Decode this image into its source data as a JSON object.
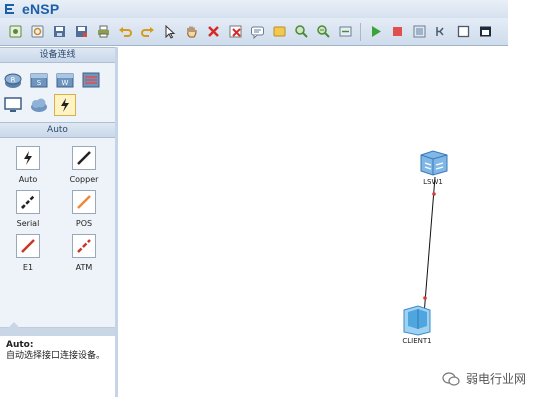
{
  "app": {
    "title": "eNSP"
  },
  "toolbar": {
    "icons": [
      "new-topology-icon",
      "open-icon",
      "save-icon",
      "save-as-icon",
      "print-icon",
      "undo-icon",
      "redo-icon",
      "select-icon",
      "pan-hand-icon",
      "delete-icon",
      "delete-all-icon",
      "text-icon",
      "palette-icon",
      "zoom-in-icon",
      "zoom-out-icon",
      "fit-icon",
      "start-icon",
      "stop-icon",
      "capture-icon",
      "console-icon",
      "window-icon",
      "exit-icon"
    ]
  },
  "left_panel": {
    "device_header": "设备连线",
    "cable_header": "Auto",
    "cables": [
      {
        "label": "Auto",
        "color": "#222222"
      },
      {
        "label": "Copper",
        "color": "#222222"
      },
      {
        "label": "Serial",
        "color": "#222222"
      },
      {
        "label": "POS",
        "color": "#f0883a"
      },
      {
        "label": "E1",
        "color": "#c9352b"
      },
      {
        "label": "ATM",
        "color": "#c9352b"
      }
    ],
    "description": {
      "title": "Auto:",
      "text": "自动选择接口连接设备。"
    }
  },
  "canvas": {
    "nodes": [
      {
        "label": "LSW1"
      },
      {
        "label": "CLIENT1"
      }
    ]
  },
  "watermark": {
    "text": "弱电行业网"
  }
}
